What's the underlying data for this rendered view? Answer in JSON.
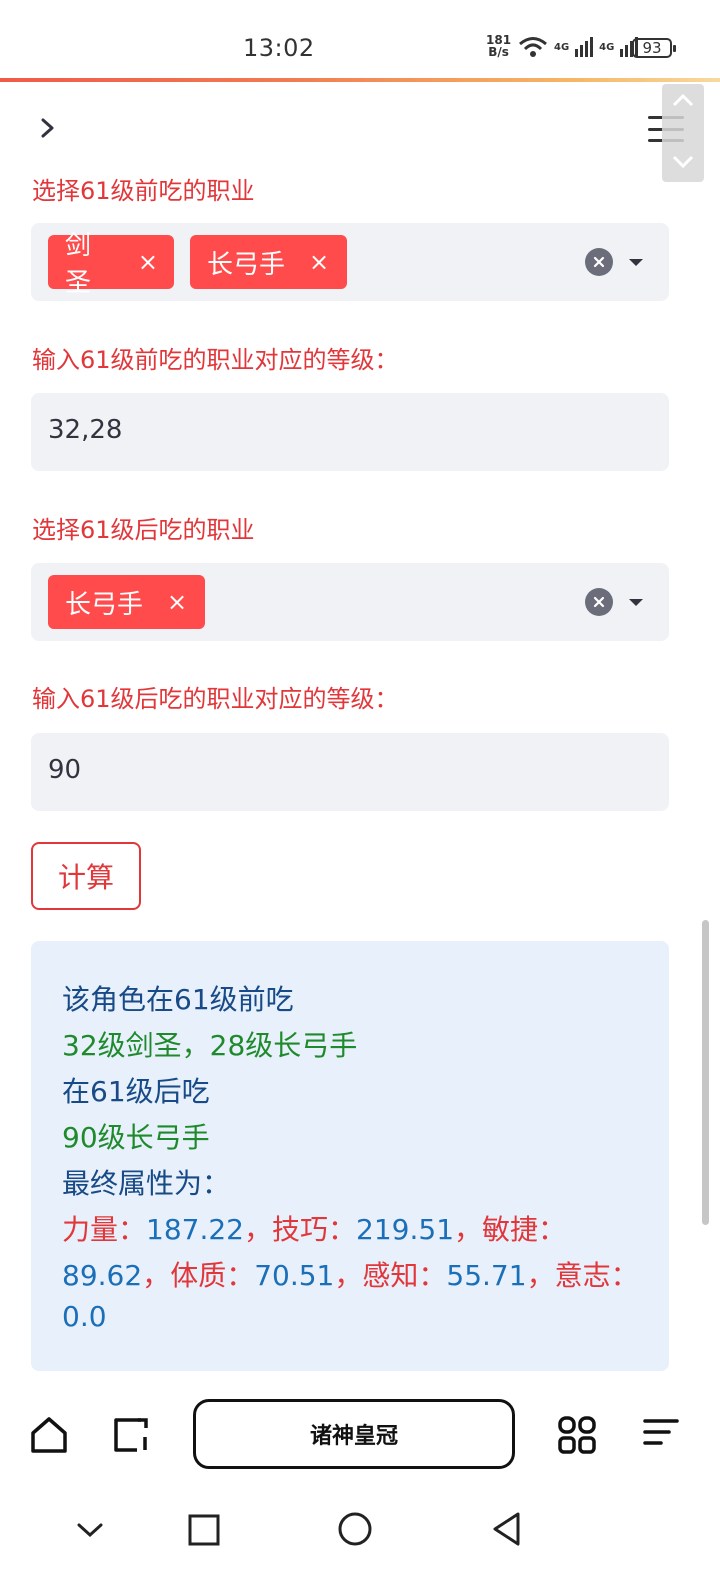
{
  "status_bar": {
    "time": "13:02",
    "net_speed_value": "181",
    "net_speed_unit": "B/s",
    "signal_1": "4G",
    "signal_2": "4G",
    "battery": "93"
  },
  "form": {
    "pre61_class_label": "选择61级前吃的职业",
    "pre61_classes": [
      {
        "label": "剑圣",
        "remove": "×"
      },
      {
        "label": "长弓手",
        "remove": "×"
      }
    ],
    "pre61_level_label": "输入61级前吃的职业对应的等级：",
    "pre61_level_value": "32,28",
    "post61_class_label": "选择61级后吃的职业",
    "post61_classes": [
      {
        "label": "长弓手",
        "remove": "×"
      }
    ],
    "post61_level_label": "输入61级后吃的职业对应的等级：",
    "post61_level_value": "90",
    "calculate_button": "计算"
  },
  "result": {
    "line1": "该角色在61级前吃",
    "line2": "32级剑圣，28级长弓手",
    "line3": "在61级后吃",
    "line4": "90级长弓手",
    "line5": "最终属性为：",
    "stats": [
      {
        "name": "力量：",
        "value": "187.22",
        "sep": "，"
      },
      {
        "name": "技巧：",
        "value": "219.51",
        "sep": "，"
      },
      {
        "name": "敏捷：",
        "value": "89.62",
        "sep": "，"
      },
      {
        "name": "体质：",
        "value": "70.51",
        "sep": "，"
      },
      {
        "name": "感知：",
        "value": "55.71",
        "sep": "，"
      },
      {
        "name": "意志：",
        "value": "0.0",
        "sep": ""
      }
    ]
  },
  "browser": {
    "address_title": "诸神皇冠"
  },
  "colors": {
    "accent_red": "#ff4b4b",
    "label_red": "#e1373a",
    "result_bg": "#e8f0fb",
    "result_green": "#1f8a2c",
    "result_blue": "#1b6fb8"
  }
}
